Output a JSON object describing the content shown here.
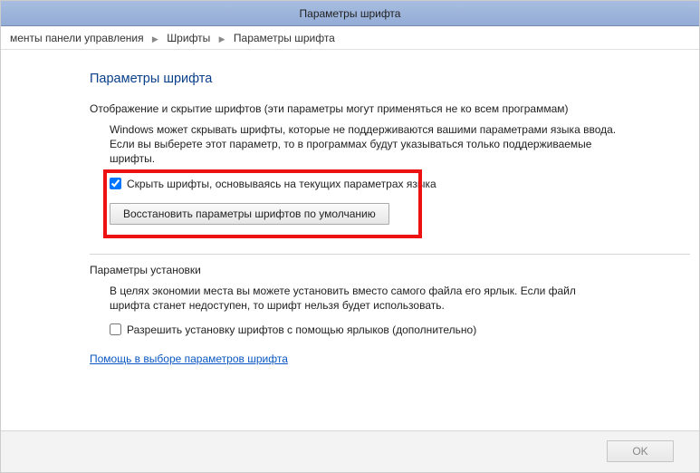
{
  "window": {
    "title": "Параметры шрифта"
  },
  "breadcrumbs": {
    "item1": "менты панели управления",
    "item2": "Шрифты",
    "item3": "Параметры шрифта"
  },
  "page": {
    "heading": "Параметры шрифта"
  },
  "section1": {
    "title": "Отображение и скрытие шрифтов (эти параметры могут применяться не ко всем программам)",
    "description": "Windows может скрывать шрифты, которые не поддерживаются вашими параметрами языка ввода. Если вы выберете этот параметр, то в программах будут указываться только поддерживаемые шрифты.",
    "checkbox_label": "Скрыть шрифты, основываясь на текущих параметрах языка",
    "checkbox_checked": true,
    "restore_button": "Восстановить параметры шрифтов по умолчанию"
  },
  "section2": {
    "title": "Параметры установки",
    "description": "В целях экономии места вы можете установить вместо самого файла его ярлык. Если файл шрифта станет недоступен, то шрифт нельзя будет использовать.",
    "checkbox_label": "Разрешить установку шрифтов с помощью ярлыков (дополнительно)",
    "checkbox_checked": false
  },
  "help_link": "Помощь в выборе параметров шрифта",
  "footer": {
    "ok": "OK"
  }
}
